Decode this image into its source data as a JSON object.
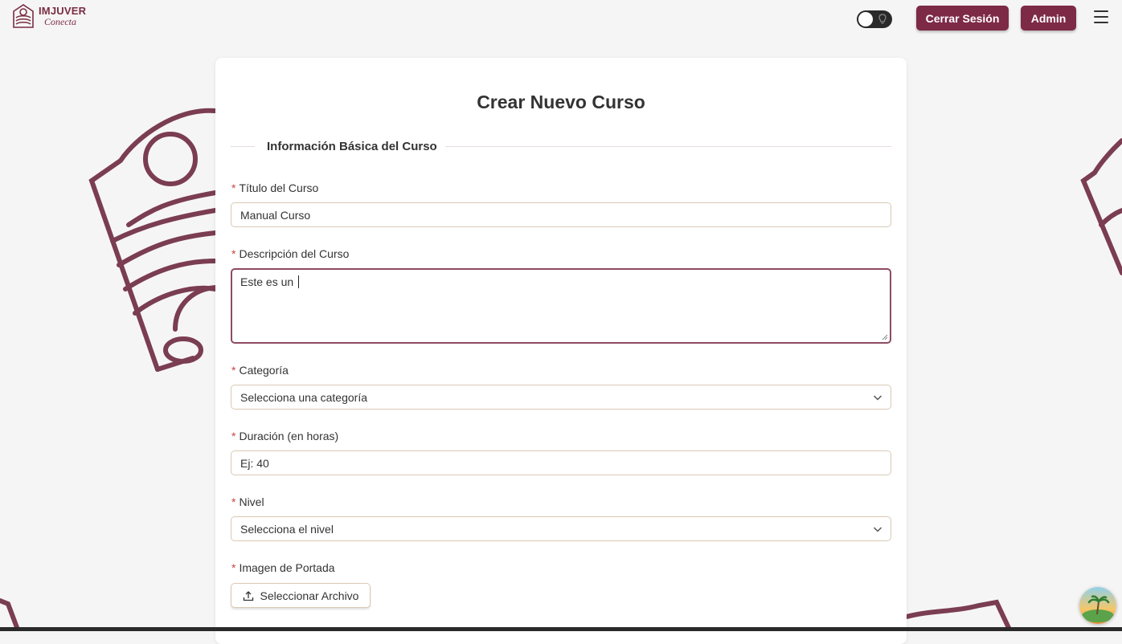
{
  "header": {
    "logo_title": "IMJUVER",
    "logo_subtitle": "Conecta",
    "theme_toggle_icon": "lightbulb-icon",
    "logout_label": "Cerrar Sesión",
    "admin_label": "Admin",
    "menu_icon": "hamburger-icon"
  },
  "form": {
    "title": "Crear Nuevo Curso",
    "section_title": "Información Básica del Curso",
    "required_mark": "*",
    "fields": {
      "titulo": {
        "label": "Título del Curso",
        "value": "Manual Curso"
      },
      "descripcion": {
        "label": "Descripción del Curso",
        "value": "Este es un "
      },
      "categoria": {
        "label": "Categoría",
        "selected": "Selecciona una categoría"
      },
      "duracion": {
        "label": "Duración (en horas)",
        "placeholder": "Ej: 40"
      },
      "nivel": {
        "label": "Nivel",
        "selected": "Selecciona el nivel"
      },
      "imagen": {
        "label": "Imagen de Portada",
        "button_label": "Seleccionar Archivo",
        "button_icon": "upload-icon"
      }
    }
  },
  "colors": {
    "brand": "#7d2a47",
    "background": "#f6f5f5",
    "decor": "#7a3d52"
  }
}
